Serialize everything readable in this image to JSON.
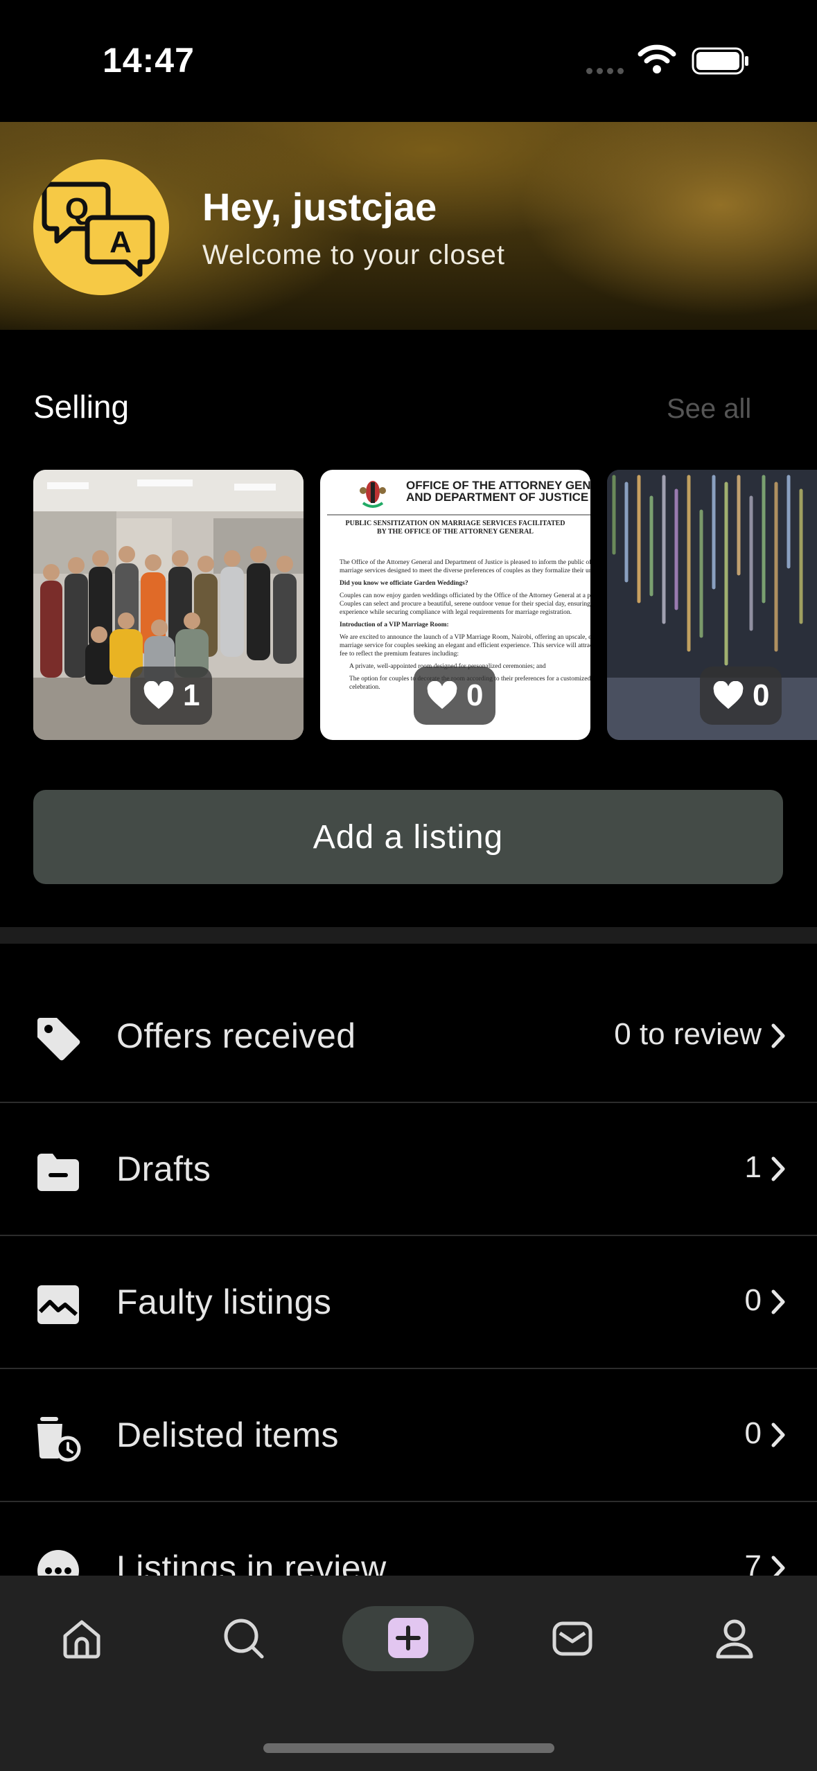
{
  "status_bar": {
    "time": "14:47"
  },
  "header": {
    "greeting": "Hey, justcjae",
    "subtitle": "Welcome to your closet",
    "avatar_letters": {
      "q": "Q",
      "a": "A"
    },
    "avatar_color": "#f6c945"
  },
  "selling": {
    "title": "Selling",
    "see_all": "See all",
    "items": [
      {
        "likes": "1"
      },
      {
        "likes": "0"
      },
      {
        "likes": "0"
      }
    ],
    "document_preview": {
      "heading_1": "OFFICE OF THE ATTORNEY GENERAL",
      "heading_2": "AND DEPARTMENT OF JUSTICE",
      "subheading": "PUBLIC SENSITIZATION ON MARRIAGE SERVICES FACILITATED BY THE OFFICE OF THE ATTORNEY GENERAL",
      "p1": "The Office of the Attorney General and Department of Justice is pleased to inform the public of enhanced marriage services designed to meet the diverse preferences of couples as they formalize their unions.",
      "q1": "Did you know we officiate Garden Weddings?",
      "p2": "Couples can now enjoy garden weddings officiated by the Office of the Attorney General at a prescribed fee. Couples can select and procure a beautiful, serene outdoor venue for their special day, ensuring a memorable experience while securing compliance with legal requirements for marriage registration.",
      "q2": "Introduction of a VIP Marriage Room:",
      "p3": "We are excited to announce the launch of a VIP Marriage Room, Nairobi, offering an upscale, expedited marriage service for couples seeking an elegant and efficient experience. This service will attract an up-scaled fee to reflect the premium features including:",
      "b1": "A private, well-appointed room designed for personalized ceremonies; and",
      "b2": "The option for couples to decorate the room according to their preferences for a customized touch to their celebration."
    },
    "add_listing": "Add a listing"
  },
  "menu": [
    {
      "icon": "tag-icon",
      "label": "Offers received",
      "value": "0 to review"
    },
    {
      "icon": "folder-icon",
      "label": "Drafts",
      "value": "1"
    },
    {
      "icon": "broken-image-icon",
      "label": "Faulty listings",
      "value": "0"
    },
    {
      "icon": "delisted-clock-icon",
      "label": "Delisted items",
      "value": "0"
    },
    {
      "icon": "chat-bubble-icon",
      "label": "Listings in review",
      "value": "7"
    }
  ],
  "tab_bar": {
    "tabs": [
      "home-icon",
      "search-icon",
      "plus-icon",
      "inbox-icon",
      "profile-icon"
    ],
    "accent": "#e2c6f0"
  }
}
